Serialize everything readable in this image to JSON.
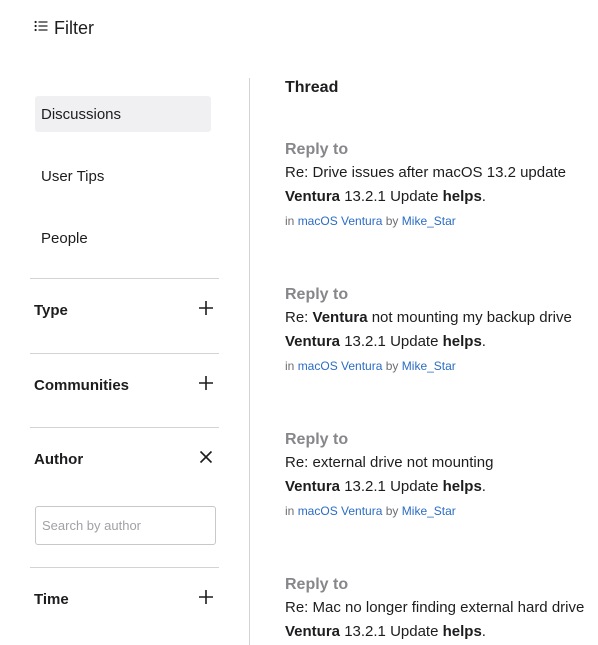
{
  "filter": {
    "label": "Filter",
    "icon": "list-icon"
  },
  "sidebar": {
    "nav_items": [
      {
        "label": "Discussions",
        "active": true
      },
      {
        "label": "User Tips",
        "active": false
      },
      {
        "label": "People",
        "active": false
      }
    ],
    "sections": [
      {
        "title": "Type",
        "state": "collapsed",
        "icon": "plus-icon"
      },
      {
        "title": "Communities",
        "state": "collapsed",
        "icon": "plus-icon"
      },
      {
        "title": "Author",
        "state": "expanded",
        "icon": "close-icon"
      },
      {
        "title": "Time",
        "state": "collapsed",
        "icon": "plus-icon"
      }
    ],
    "author_search": {
      "placeholder": "Search by author",
      "value": ""
    }
  },
  "main": {
    "heading": "Thread",
    "results": [
      {
        "kind": "Reply to",
        "title_parts": [
          {
            "text": "Re: Drive issues after macOS 13.2 update",
            "bold": false
          }
        ],
        "snippet_parts": [
          {
            "text": "Ventura",
            "bold": true
          },
          {
            "text": " 13.2.1 Update ",
            "bold": false
          },
          {
            "text": "helps",
            "bold": true
          },
          {
            "text": ".",
            "bold": false
          }
        ],
        "meta": {
          "in_label": "in",
          "community": "macOS Ventura",
          "by_label": "by",
          "author": "Mike_Star"
        }
      },
      {
        "kind": "Reply to",
        "title_parts": [
          {
            "text": "Re: ",
            "bold": false
          },
          {
            "text": "Ventura",
            "bold": true
          },
          {
            "text": " not mounting my backup drive",
            "bold": false
          }
        ],
        "snippet_parts": [
          {
            "text": "Ventura",
            "bold": true
          },
          {
            "text": " 13.2.1 Update ",
            "bold": false
          },
          {
            "text": "helps",
            "bold": true
          },
          {
            "text": ".",
            "bold": false
          }
        ],
        "meta": {
          "in_label": "in",
          "community": "macOS Ventura",
          "by_label": "by",
          "author": "Mike_Star"
        }
      },
      {
        "kind": "Reply to",
        "title_parts": [
          {
            "text": "Re: external drive not mounting",
            "bold": false
          }
        ],
        "snippet_parts": [
          {
            "text": "Ventura",
            "bold": true
          },
          {
            "text": " 13.2.1 Update ",
            "bold": false
          },
          {
            "text": "helps",
            "bold": true
          },
          {
            "text": ".",
            "bold": false
          }
        ],
        "meta": {
          "in_label": "in",
          "community": "macOS Ventura",
          "by_label": "by",
          "author": "Mike_Star"
        }
      },
      {
        "kind": "Reply to",
        "title_parts": [
          {
            "text": "Re: Mac no longer finding external hard drive",
            "bold": false
          }
        ],
        "snippet_parts": [
          {
            "text": "Ventura",
            "bold": true
          },
          {
            "text": " 13.2.1 Update ",
            "bold": false
          },
          {
            "text": "helps",
            "bold": true
          },
          {
            "text": ".",
            "bold": false
          }
        ],
        "meta": null
      }
    ]
  }
}
